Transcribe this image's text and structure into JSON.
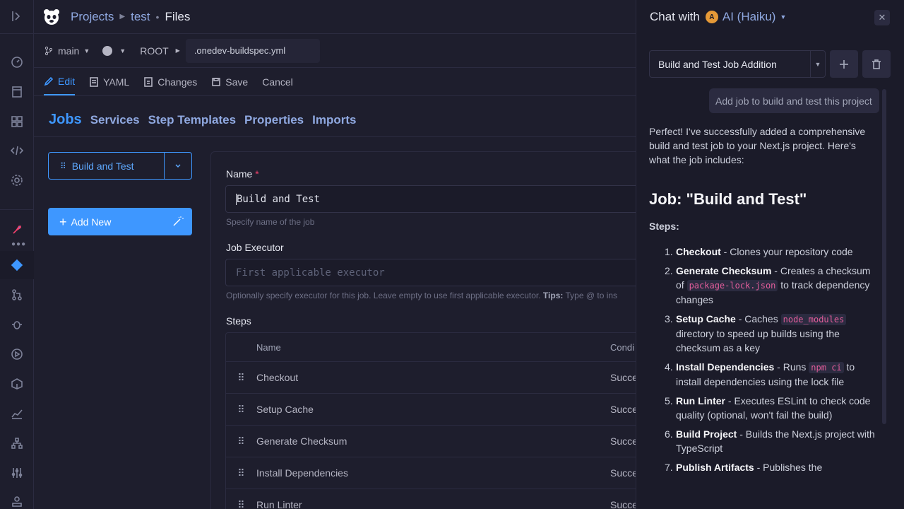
{
  "breadcrumb": {
    "projects": "Projects",
    "project": "test",
    "files": "Files"
  },
  "pathbar": {
    "branch": "main",
    "root": "ROOT",
    "filename": ".onedev-buildspec.yml"
  },
  "toolbar": {
    "edit": "Edit",
    "yaml": "YAML",
    "changes": "Changes",
    "save": "Save",
    "cancel": "Cancel"
  },
  "sections": {
    "jobs": "Jobs",
    "services": "Services",
    "step_templates": "Step Templates",
    "properties": "Properties",
    "imports": "Imports"
  },
  "job": {
    "selected": "Build and Test",
    "add_new": "Add New"
  },
  "form": {
    "name_label": "Name",
    "required_mark": "*",
    "name_value": "Build and Test",
    "name_help": "Specify name of the job",
    "executor_label": "Job Executor",
    "executor_placeholder": "First applicable executor",
    "executor_help": "Optionally specify executor for this job. Leave empty to use first applicable executor.",
    "executor_tips": "Tips:",
    "executor_tips_text": "Type @ to ins",
    "steps_label": "Steps"
  },
  "steps_table": {
    "col_name": "Name",
    "col_condition": "Condi",
    "rows": [
      {
        "name": "Checkout",
        "condition": "Succe"
      },
      {
        "name": "Setup Cache",
        "condition": "Succe"
      },
      {
        "name": "Generate Checksum",
        "condition": "Succe"
      },
      {
        "name": "Install Dependencies",
        "condition": "Succe"
      },
      {
        "name": "Run Linter",
        "condition": "Succe"
      }
    ]
  },
  "chat": {
    "title": "Chat with",
    "avatar_letter": "A",
    "ai_name": "AI (Haiku)",
    "conversation": "Build and Test Job Addition",
    "user_message": "Add job to build and test this project",
    "intro": "Perfect! I've successfully added a comprehensive build and test job to your Next.js project. Here's what the job includes:",
    "heading": "Job: \"Build and Test\"",
    "steps_heading": "Steps:",
    "steps": [
      {
        "num": "1.",
        "title": "Checkout",
        "pre": " - Clones your repository code",
        "code": "",
        "post": ""
      },
      {
        "num": "2.",
        "title": "Generate Checksum",
        "pre": " - Creates a checksum of ",
        "code": "package-lock.json",
        "post": " to track dependency changes"
      },
      {
        "num": "3.",
        "title": "Setup Cache",
        "pre": " - Caches ",
        "code": "node_modules",
        "post": " directory to speed up builds using the checksum as a key"
      },
      {
        "num": "4.",
        "title": "Install Dependencies",
        "pre": " - Runs ",
        "code": "npm ci",
        "post": " to install dependencies using the lock file"
      },
      {
        "num": "5.",
        "title": "Run Linter",
        "pre": " - Executes ESLint to check code quality (optional, won't fail the build)",
        "code": "",
        "post": ""
      },
      {
        "num": "6.",
        "title": "Build Project",
        "pre": " - Builds the Next.js project with TypeScript",
        "code": "",
        "post": ""
      },
      {
        "num": "7.",
        "title": "Publish Artifacts",
        "pre": " - Publishes the",
        "code": "",
        "post": ""
      }
    ]
  },
  "colors": {
    "accent": "#3e97ff",
    "background": "#1e1e2d",
    "chat_bg": "#1b1b29",
    "code": "#e35d9b"
  }
}
